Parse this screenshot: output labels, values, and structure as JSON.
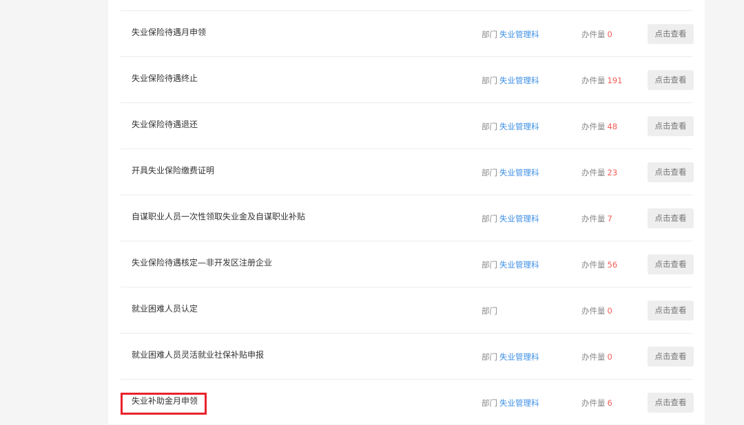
{
  "labels": {
    "dept_prefix": "部门",
    "count_prefix": "办件量",
    "view_button": "点击查看"
  },
  "accent_colors": {
    "link": "#3a8ee6",
    "count": "#f25c54",
    "highlight": "#e8222b"
  },
  "items": [
    {
      "title": "失业保险待遇月申领",
      "dept": "失业管理科",
      "count": "0"
    },
    {
      "title": "失业保险待遇终止",
      "dept": "失业管理科",
      "count": "191"
    },
    {
      "title": "失业保险待遇退还",
      "dept": "失业管理科",
      "count": "48"
    },
    {
      "title": "开具失业保险缴费证明",
      "dept": "失业管理科",
      "count": "23"
    },
    {
      "title": "自谋职业人员一次性领取失业金及自谋职业补贴",
      "dept": "失业管理科",
      "count": "7"
    },
    {
      "title": "失业保险待遇核定—非开发区注册企业",
      "dept": "失业管理科",
      "count": "56"
    },
    {
      "title": "就业困难人员认定",
      "dept": "",
      "count": "0"
    },
    {
      "title": "就业困难人员灵活就业社保补贴申报",
      "dept": "失业管理科",
      "count": "0"
    },
    {
      "title": "失业补助金月申领",
      "dept": "失业管理科",
      "count": "6",
      "highlighted": true
    }
  ]
}
